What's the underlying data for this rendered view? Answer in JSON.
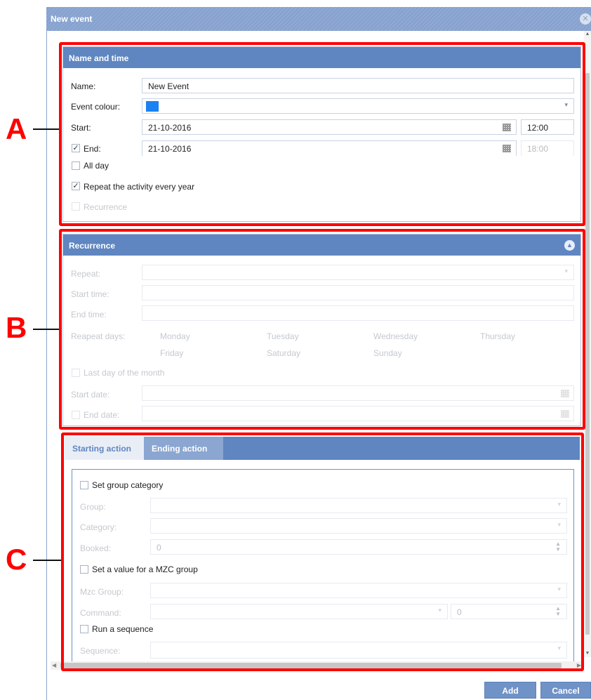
{
  "dialog": {
    "title": "New event"
  },
  "name_time": {
    "header": "Name and time",
    "name_label": "Name:",
    "name_value": "New Event",
    "colour_label": "Event colour:",
    "colour_value": "#1a82f2",
    "start_label": "Start:",
    "start_date": "21-10-2016",
    "start_time": "12:00",
    "end_label": "End:",
    "end_checked": true,
    "end_date": "21-10-2016",
    "end_time": "18:00",
    "allday_label": "All day",
    "allday_checked": false,
    "repeat_label": "Repeat the activity every year",
    "repeat_checked": true,
    "recurrence_label": "Recurrence",
    "recurrence_checked": false
  },
  "recurrence": {
    "header": "Recurrence",
    "repeat_label": "Repeat:",
    "start_time_label": "Start time:",
    "end_time_label": "End time:",
    "days_label": "Reapeat days:",
    "days": [
      "Monday",
      "Tuesday",
      "Wednesday",
      "Thursday",
      "Friday",
      "Saturday",
      "Sunday"
    ],
    "last_day_label": "Last day of the month",
    "start_date_label": "Start date:",
    "end_date_label": "End date:"
  },
  "actions": {
    "tabs": [
      "Starting action",
      "Ending action"
    ],
    "active_tab": "Starting action",
    "set_group_label": "Set group category",
    "group_label": "Group:",
    "category_label": "Category:",
    "booked_label": "Booked:",
    "booked_value": "0",
    "mzc_label": "Set a value for a MZC group",
    "mzc_group_label": "Mzc Group:",
    "command_label": "Command:",
    "command_value": "0",
    "run_seq_label": "Run a sequence",
    "sequence_label": "Sequence:"
  },
  "footer": {
    "add_label": "Add",
    "cancel_label": "Cancel"
  },
  "annotations": {
    "a": "A",
    "b": "B",
    "c": "C",
    "color": "#ff0000"
  }
}
